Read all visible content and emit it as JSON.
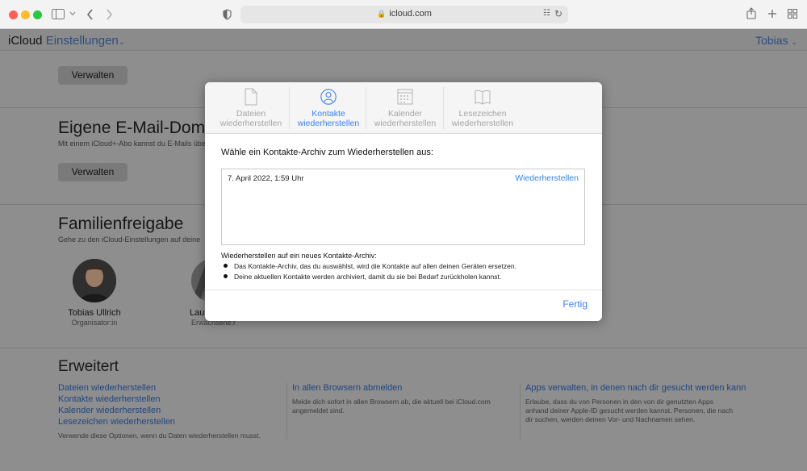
{
  "browser": {
    "url": "icloud.com",
    "icons": [
      "sidebar-icon",
      "chevron-down-icon",
      "back-icon",
      "forward-icon",
      "privacy-icon",
      "lock-icon",
      "translate-icon",
      "reload-icon",
      "share-icon",
      "new-tab-icon",
      "tab-overview-icon"
    ]
  },
  "header": {
    "brand_icloud": "iCloud",
    "brand_settings": "Einstellungen",
    "user": "Tobias"
  },
  "top_section": {
    "manage_label": "Verwalten"
  },
  "email_section": {
    "title": "Eigene E-Mail-Domain",
    "subtitle": "Mit einem iCloud+-Abo kannst du E-Mails über",
    "manage_label": "Verwalten"
  },
  "family_section": {
    "title": "Familienfreigabe",
    "subtitle": "Gehe zu den iCloud-Einstellungen auf deine",
    "members": [
      {
        "name": "Tobias Ullrich",
        "role": "Organisator:in"
      },
      {
        "name": "Lau",
        "role": "Erwachsene:r"
      }
    ]
  },
  "advanced_section": {
    "title": "Erweitert",
    "restore_links": [
      "Dateien wiederherstellen",
      "Kontakte wiederherstellen",
      "Kalender wiederherstellen",
      "Lesezeichen wiederherstellen"
    ],
    "restore_note": "Verwende diese Optionen, wenn du Daten wiederherstellen musst.",
    "signout_link": "In allen Browsern abmelden",
    "signout_note_1": "Melde dich sofort in allen Browsern ab, die aktuell bei iCloud.com",
    "signout_note_2": "angemeldet sind.",
    "apps_link": "Apps verwalten, in denen nach dir gesucht werden kann",
    "apps_note_1": "Erlaube, dass du von Personen in den von dir genutzten Apps",
    "apps_note_2": "anhand deiner Apple-ID gesucht werden kannst. Personen, die nach",
    "apps_note_3": "dir suchen, werden deinen Vor- und Nachnamen sehen."
  },
  "modal": {
    "tabs": [
      {
        "line1": "Dateien",
        "line2": "wiederherstellen",
        "icon": "document-icon"
      },
      {
        "line1": "Kontakte",
        "line2": "wiederherstellen",
        "icon": "contact-icon"
      },
      {
        "line1": "Kalender",
        "line2": "wiederherstellen",
        "icon": "calendar-icon"
      },
      {
        "line1": "Lesezeichen",
        "line2": "wiederherstellen",
        "icon": "book-icon"
      }
    ],
    "active_tab": "Kontakte",
    "heading": "Wähle ein Kontakte-Archiv zum Wiederherstellen aus:",
    "archives": [
      {
        "date": "7. April 2022, 1:59 Uhr",
        "action": "Wiederherstellen"
      }
    ],
    "info_title": "Wiederherstellen auf ein neues Kontakte-Archiv:",
    "info_bullets": [
      "Das Kontakte-Archiv, das du auswählst, wird die Kontakte auf allen deinen Geräten ersetzen.",
      "Deine aktuellen Kontakte werden archiviert, damit du sie bei Bedarf zurückholen kannst."
    ],
    "done_label": "Fertig"
  },
  "colors": {
    "accent": "#3b82f6",
    "dim_link": "#1f4680",
    "overlay": "#8e8e8e"
  }
}
